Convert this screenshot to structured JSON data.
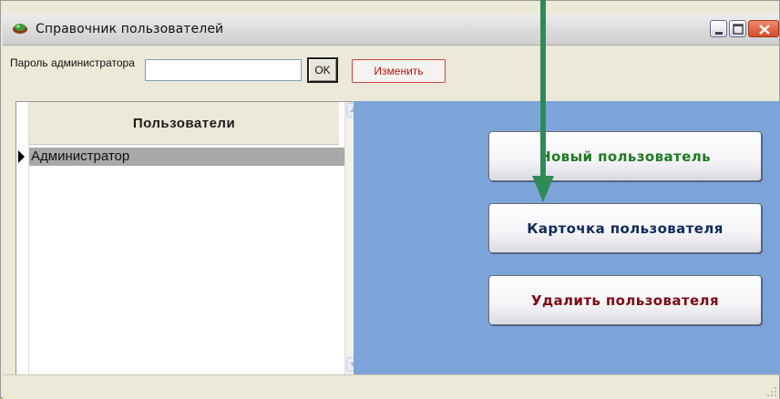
{
  "window": {
    "title": "Справочник пользователей",
    "icons": {
      "app": "app-icon",
      "minimize": "minimize-icon",
      "maximize": "maximize-icon",
      "close": "close-icon"
    }
  },
  "toolbar": {
    "password_label": "Пароль администратора",
    "password_value": "",
    "ok_label": "OK",
    "change_label": "Изменить"
  },
  "users_grid": {
    "header": "Пользователи",
    "rows": [
      {
        "name": "Администратор"
      }
    ]
  },
  "actions": {
    "new_user": "Новый пользователь",
    "user_card": "Карточка пользователя",
    "delete_user": "Удалить пользователя"
  },
  "colors": {
    "panel_bg": "#7da4d8",
    "new_user_text": "#1f7a21",
    "user_card_text": "#102a5a",
    "delete_user_text": "#7d0b12",
    "change_text": "#c01010",
    "arrow": "#2e8b57"
  }
}
